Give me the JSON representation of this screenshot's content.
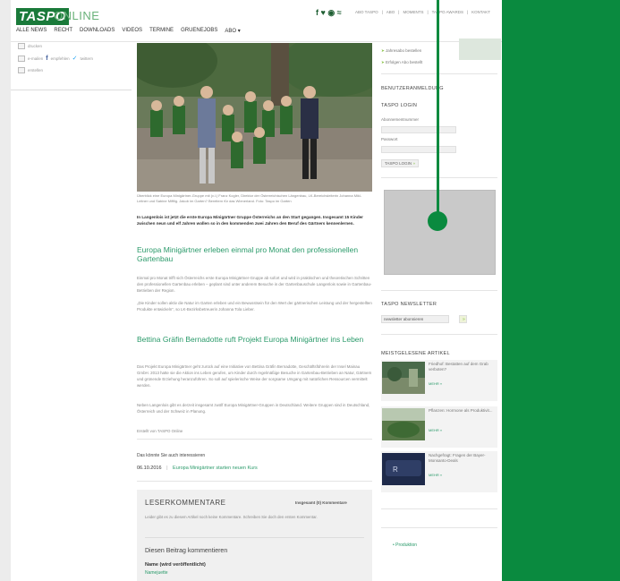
{
  "header": {
    "logo_text": "TASPO",
    "logo_suffix": "ONLINE",
    "social_icons": [
      "facebook-icon",
      "twitter-icon",
      "rss-icon",
      "feed-icon"
    ],
    "social_glyphs": "f ♥ ◉ ≈",
    "top_links": [
      "ABO TASPO",
      "ABO",
      "MOMENTS",
      "TASPO AWARDS",
      "KONTAKT"
    ],
    "nav": [
      "ALLE NEWS",
      "RECHT",
      "DOWNLOADS",
      "VIDEOS",
      "TERMINE",
      "GRUENEJOBS",
      "ABO ▾"
    ]
  },
  "left_tools": {
    "items": [
      "drucken",
      "e-mailen",
      "empfehlen",
      "twittern",
      "erstellen"
    ]
  },
  "article": {
    "caption": "Überblick eine Europa Minigärtner-Gruppe mit (v.l.) Franz Kogler, Direktor der Österreichischen Längenbau, LK-Bereichsleiterin Johanna Mikl-Leitner und Sabine Mifflig. Jakob im Garten? Bereitern für das Wienerland. Foto: Taspo im Garten",
    "intro": "In Langenlois ist jetzt die erste Europa Minigärtner Gruppe Österreichs an den Start gegangen. Insgesamt 15 Kinder zwischen neun und elf Jahren wollen so in den kommenden zwei Jahren den Beruf des Gärtners kennenlernen.",
    "heading1": "Europa Minigärtner erleben einmal pro Monat den professionellen Gartenbau",
    "para1": "Einmal pro Monat trifft sich Österreichs erste Europa Minigärtner-Gruppe ab sofort und wird in praktischen und theoretischen Schritten den professionellen Gartenbau erleben – geplant sind unter anderem Besuche in der Gartenbauschule Langenlois sowie in Gartenbau-Betrieben der Region.",
    "para2": "„Die Kinder sollen aktiv die Natur im Garten erleben und ein Bewusstsein für den Wert der gärtnerischen Leistung und der hergestellten Produkte entwickeln“, so LK-Bezirksbetreuerin Johanna Tola Lieber.",
    "heading2": "Bettina Gräfin Bernadotte ruft Projekt Europa Minigärtner ins Leben",
    "para3": "Das Projekt Europa Minigärtner geht zurück auf eine Initiative von Bettina Gräfin Bernadotte, Geschäftsführerin der Insel Mainau GmbH. 2013 hatte sie die Aktion ins Leben gerufen, um Kinder durch regelmäßige Besuche in Gartenbau-Betrieben an Natur, Gärtnern und grünende Erziehung heranzuführen. So soll auf spielerische Weise der sorgsame Umgang mit natürlichen Ressourcen vermittelt werden.",
    "para4": "Neben Langenlois gibt es derzeit insgesamt zwölf Europa Minigärtner-Gruppen in Deutschland. Weitere Gruppen sind in Deutschland, Österreich und der Schweiz in Planung.",
    "source": "Erstellt von TASPO Online",
    "related_label": "Das könnte Sie auch interessieren",
    "related_date": "06.10.2016",
    "related_sep": "|",
    "related_title": "Europa Minigärtner starten neuen Kurs"
  },
  "comments": {
    "title": "LESERKOMMENTARE",
    "count": "Insgesamt (0) Kommentare",
    "empty_text": "Leider gibt es zu diesem Artikel noch keine Kommentare. Schreiben Sie doch den ersten Kommentar.",
    "sub_title": "Diesen Beitrag kommentieren",
    "name_label": "Name (wird veröffentlicht)",
    "name_placeholder": "Namejuette"
  },
  "sidebar": {
    "top_items": [
      "Jahresabo bestellen",
      "Erfolgen Abo bestellt"
    ],
    "login_title": "BENUTZERANMELDUNG",
    "login_sub": "TASPO LOGIN",
    "user_label": "Abonnementnummer",
    "pass_label": "Passwort",
    "login_button": "TASPO LOGIN",
    "login_arrow": "»",
    "newsletter_title": "TASPO NEWSLETTER",
    "newsletter_select": "newsletter abonnieren",
    "newsletter_arrow": "»",
    "popular_title": "MEISTGELESENE ARTIKEL",
    "articles": [
      {
        "text": "Friedhof: Bestatten auf dem Grab verboten?",
        "more": "MEHR »"
      },
      {
        "text": "Pflanzen: Hormone als Produktivit...",
        "more": "MEHR »"
      },
      {
        "text": "Nachgefragt: Fragen der Bayer-Monsanto-Deals",
        "more": "MEHR »"
      }
    ],
    "footer_link": "• Produktion"
  },
  "colors": {
    "brand_green": "#0a8a3f",
    "link_green": "#2a9a6a"
  }
}
